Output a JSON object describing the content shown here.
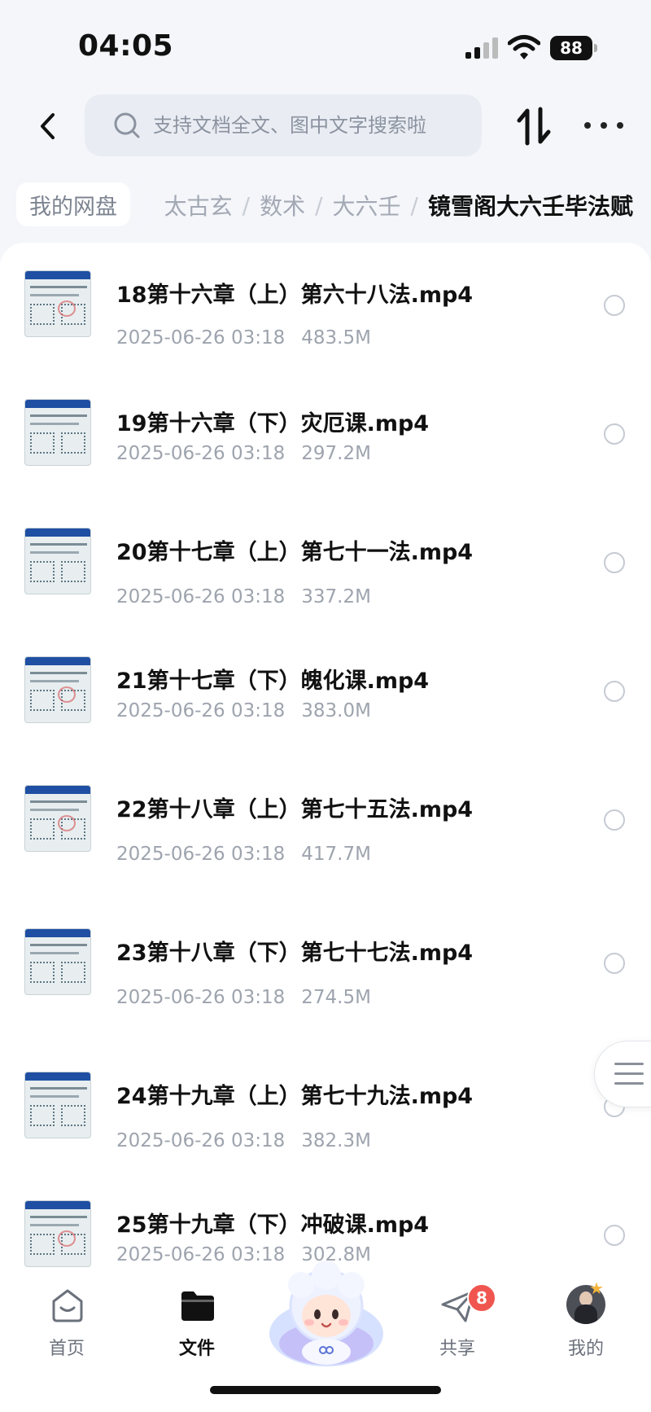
{
  "status": {
    "time": "04:05",
    "battery": "88"
  },
  "search": {
    "placeholder": "支持文档全文、图中文字搜索啦"
  },
  "breadcrumb": {
    "root": "我的网盘",
    "trail": [
      "太古玄",
      "数术",
      "大六壬"
    ],
    "current": "镜雪阁大六壬毕法赋"
  },
  "files": [
    {
      "name": "18第十六章（上）第六十八法.mp4",
      "date": "2025-06-26 03:18",
      "size": "483.5M"
    },
    {
      "name": "19第十六章（下）灾厄课.mp4",
      "date": "2025-06-26 03:18",
      "size": "297.2M"
    },
    {
      "name": "20第十七章（上）第七十一法.mp4",
      "date": "2025-06-26 03:18",
      "size": "337.2M"
    },
    {
      "name": "21第十七章（下）魄化课.mp4",
      "date": "2025-06-26 03:18",
      "size": "383.0M"
    },
    {
      "name": "22第十八章（上）第七十五法.mp4",
      "date": "2025-06-26 03:18",
      "size": "417.7M"
    },
    {
      "name": "23第十八章（下）第七十七法.mp4",
      "date": "2025-06-26 03:18",
      "size": "274.5M"
    },
    {
      "name": "24第十九章（上）第七十九法.mp4",
      "date": "2025-06-26 03:18",
      "size": "382.3M"
    },
    {
      "name": "25第十九章（下）冲破课.mp4",
      "date": "2025-06-26 03:18",
      "size": "302.8M"
    }
  ],
  "tabbar": {
    "home": "首页",
    "files": "文件",
    "share": "共享",
    "share_badge": "8",
    "mine": "我的"
  },
  "colors": {
    "accent": "#111111",
    "badge": "#f0564f",
    "muted": "#9ea4ae"
  }
}
